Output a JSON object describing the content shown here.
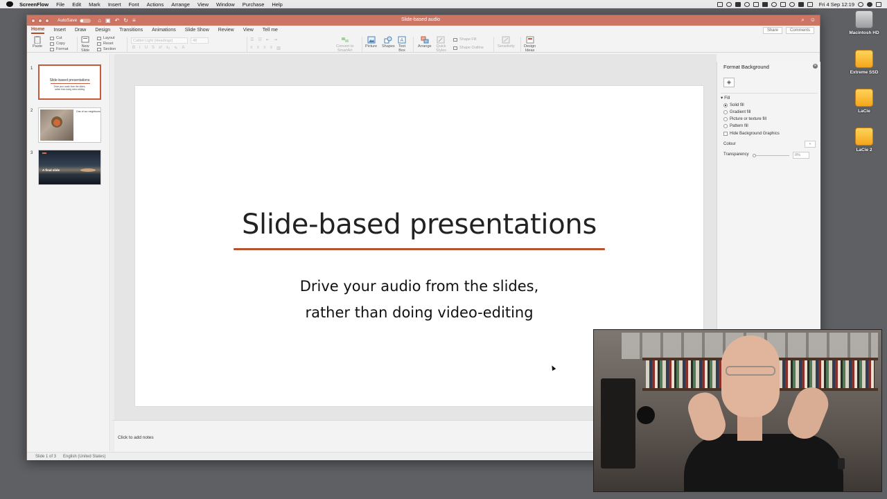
{
  "menubar": {
    "app_name": "ScreenFlow",
    "items": [
      "File",
      "Edit",
      "Mark",
      "Insert",
      "Font",
      "Actions",
      "Arrange",
      "View",
      "Window",
      "Purchase",
      "Help"
    ],
    "clock": "Fri 4 Sep  12:19"
  },
  "desktop": {
    "icons": [
      {
        "label": "Macintosh HD",
        "kind": "gray"
      },
      {
        "label": "Extreme SSD",
        "kind": "orange"
      },
      {
        "label": "LaCie",
        "kind": "orange"
      },
      {
        "label": "LaCie 2",
        "kind": "orange"
      }
    ]
  },
  "window": {
    "autosave_label": "AutoSave",
    "autosave_state": "OFF",
    "doc_title": "Slide-based audio",
    "tabs": [
      "Home",
      "Insert",
      "Draw",
      "Design",
      "Transitions",
      "Animations",
      "Slide Show",
      "Review",
      "View",
      "Tell me"
    ],
    "active_tab": "Home",
    "share_label": "Share",
    "comments_label": "Comments"
  },
  "toolbar": {
    "paste": "Paste",
    "cut": "Cut",
    "copy": "Copy",
    "format": "Format",
    "new_slide": "New\nSlide",
    "layout": "Layout",
    "reset": "Reset",
    "section": "Section",
    "font_name": "Calibri Light (Headings)",
    "font_size": "48",
    "convert_smartart": "Convert to\nSmartArt",
    "picture": "Picture",
    "shapes": "Shapes",
    "text_box": "Text\nBox",
    "arrange": "Arrange",
    "quick_styles": "Quick\nStyles",
    "shape_fill": "Shape Fill",
    "shape_outline": "Shape Outline",
    "sensitivity": "Sensitivity",
    "design_ideas": "Design\nIdeas"
  },
  "thumbnails": [
    {
      "num": "1",
      "title": "Slide-based presentations",
      "subtitle": "Drive your audio from the slides,\nrather than doing video-editing",
      "selected": true
    },
    {
      "num": "2",
      "caption": "One of our neighbours"
    },
    {
      "num": "3",
      "title": "A final slide"
    }
  ],
  "slide": {
    "title": "Slide-based presentations",
    "subtitle_line1": "Drive your audio from the slides,",
    "subtitle_line2": "rather than doing video-editing",
    "accent_color": "#b7522f"
  },
  "notes_placeholder": "Click to add notes",
  "status": {
    "slide_info": "Slide 1 of 3",
    "language": "English (United States)"
  },
  "format_pane": {
    "title": "Format Background",
    "section": "Fill",
    "options": [
      {
        "label": "Solid fill",
        "selected": true
      },
      {
        "label": "Gradient fill",
        "selected": false
      },
      {
        "label": "Picture or texture fill",
        "selected": false
      },
      {
        "label": "Pattern fill",
        "selected": false
      }
    ],
    "hide_graphics": "Hide Background Graphics",
    "colour_label": "Colour",
    "transparency_label": "Transparency",
    "transparency_value": "0%"
  }
}
